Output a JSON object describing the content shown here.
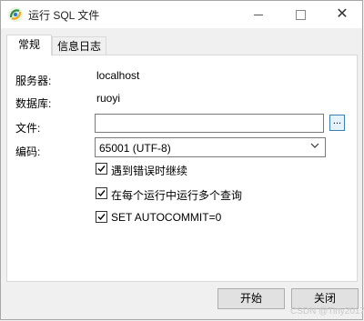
{
  "window": {
    "title": "运行 SQL 文件",
    "controls": {
      "minimize": "minimize",
      "maximize": "maximize",
      "close": "✕"
    }
  },
  "tabs": [
    {
      "label": "常规",
      "active": true
    },
    {
      "label": "信息日志",
      "active": false
    }
  ],
  "form": {
    "server_label": "服务器:",
    "server_value": "localhost",
    "database_label": "数据库:",
    "database_value": "ruoyi",
    "file_label": "文件:",
    "file_value": "",
    "browse_label": "...",
    "encoding_label": "编码:",
    "encoding_value": "65001 (UTF-8)"
  },
  "options": [
    {
      "label": "遇到错误时继续",
      "checked": true
    },
    {
      "label": "在每个运行中运行多个查询",
      "checked": true
    },
    {
      "label": "SET AUTOCOMMIT=0",
      "checked": true
    }
  ],
  "buttons": {
    "start": "开始",
    "close": "关闭"
  },
  "watermark": "CSDN @Tiny2017",
  "colors": {
    "accent": "#0078d7",
    "browse_border": "#3c7fb1"
  },
  "icons": {
    "app": "navicat-app-icon",
    "chevron": "chevron-down-icon",
    "check": "check-icon"
  }
}
